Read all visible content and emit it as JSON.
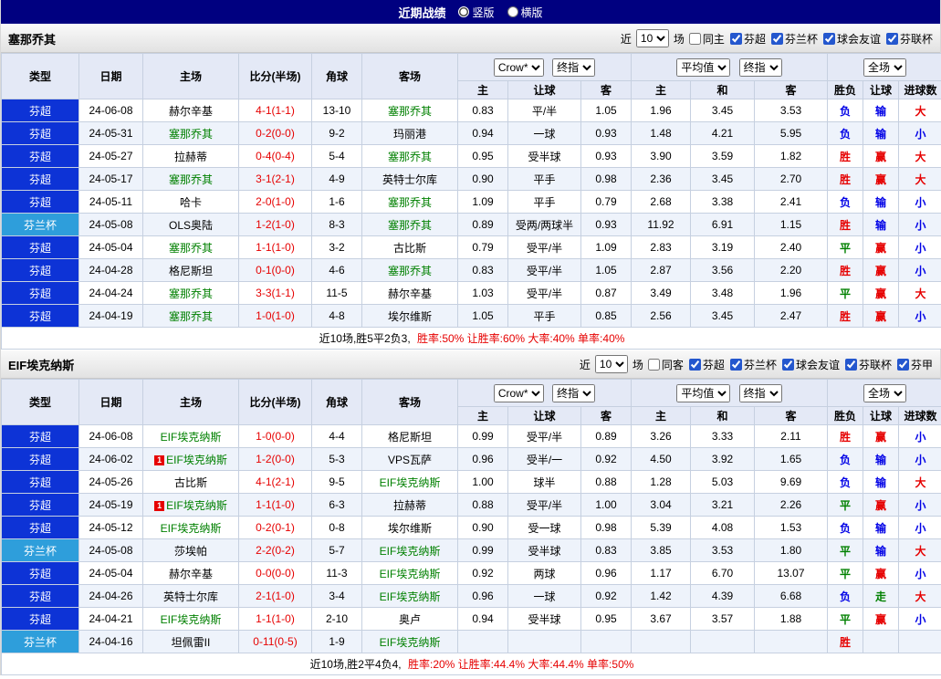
{
  "topbar": {
    "title": "近期战绩",
    "options": [
      {
        "label": "竖版",
        "selected": true
      },
      {
        "label": "横版",
        "selected": false
      }
    ]
  },
  "colors": {
    "topbar_bg": "#000080",
    "league_super": "#0d33d6",
    "league_cup": "#2e9edb",
    "highlight_team": "#008000",
    "score_red": "#e60000",
    "win_red": "#e60000",
    "draw_green": "#008000",
    "lose_blue": "#0000e6",
    "header_bg": "#e4e9f6",
    "row_alt": "#eef3fb"
  },
  "columns": {
    "type": "类型",
    "date": "日期",
    "home": "主场",
    "score": "比分(半场)",
    "corners": "角球",
    "away": "客场",
    "h": "主",
    "handicap": "让球",
    "a": "客",
    "eu_h": "主",
    "draw": "和",
    "eu_a": "客",
    "result": "胜负",
    "handicap_result": "让球",
    "goals": "进球数"
  },
  "selects": {
    "company": "Crow*",
    "final": "终指",
    "average": "平均值",
    "full": "全场"
  },
  "sections": [
    {
      "team": "塞那乔其",
      "filters": {
        "near": "近",
        "count": "10",
        "games": "场",
        "checkboxes": [
          {
            "label": "同主",
            "checked": false
          },
          {
            "label": "芬超",
            "checked": true
          },
          {
            "label": "芬兰杯",
            "checked": true
          },
          {
            "label": "球会友谊",
            "checked": true
          },
          {
            "label": "芬联杯",
            "checked": true
          }
        ]
      },
      "rows": [
        {
          "type": "芬超",
          "date": "24-06-08",
          "home": {
            "name": "赫尔辛基"
          },
          "score": "4-1(1-1)",
          "corners": "13-10",
          "away": {
            "name": "塞那乔其",
            "highlight": true
          },
          "asia": [
            "0.83",
            "平/半",
            "1.05"
          ],
          "europe": [
            "1.96",
            "3.45",
            "3.53"
          ],
          "results": [
            "负",
            "输",
            "大"
          ]
        },
        {
          "type": "芬超",
          "date": "24-05-31",
          "home": {
            "name": "塞那乔其",
            "highlight": true
          },
          "score": "0-2(0-0)",
          "corners": "9-2",
          "away": {
            "name": "玛丽港"
          },
          "asia": [
            "0.94",
            "一球",
            "0.93"
          ],
          "europe": [
            "1.48",
            "4.21",
            "5.95"
          ],
          "results": [
            "负",
            "输",
            "小"
          ]
        },
        {
          "type": "芬超",
          "date": "24-05-27",
          "home": {
            "name": "拉赫蒂"
          },
          "score": "0-4(0-4)",
          "corners": "5-4",
          "away": {
            "name": "塞那乔其",
            "highlight": true
          },
          "asia": [
            "0.95",
            "受半球",
            "0.93"
          ],
          "europe": [
            "3.90",
            "3.59",
            "1.82"
          ],
          "results": [
            "胜",
            "赢",
            "大"
          ]
        },
        {
          "type": "芬超",
          "date": "24-05-17",
          "home": {
            "name": "塞那乔其",
            "highlight": true
          },
          "score": "3-1(2-1)",
          "corners": "4-9",
          "away": {
            "name": "英特士尔库"
          },
          "asia": [
            "0.90",
            "平手",
            "0.98"
          ],
          "europe": [
            "2.36",
            "3.45",
            "2.70"
          ],
          "results": [
            "胜",
            "赢",
            "大"
          ]
        },
        {
          "type": "芬超",
          "date": "24-05-11",
          "home": {
            "name": "哈卡"
          },
          "score": "2-0(1-0)",
          "corners": "1-6",
          "away": {
            "name": "塞那乔其",
            "highlight": true
          },
          "asia": [
            "1.09",
            "平手",
            "0.79"
          ],
          "europe": [
            "2.68",
            "3.38",
            "2.41"
          ],
          "results": [
            "负",
            "输",
            "小"
          ]
        },
        {
          "type": "芬兰杯",
          "date": "24-05-08",
          "home": {
            "name": "OLS奥陆"
          },
          "score": "1-2(1-0)",
          "corners": "8-3",
          "away": {
            "name": "塞那乔其",
            "highlight": true
          },
          "asia": [
            "0.89",
            "受两/两球半",
            "0.93"
          ],
          "europe": [
            "11.92",
            "6.91",
            "1.15"
          ],
          "results": [
            "胜",
            "输",
            "小"
          ]
        },
        {
          "type": "芬超",
          "date": "24-05-04",
          "home": {
            "name": "塞那乔其",
            "highlight": true
          },
          "score": "1-1(1-0)",
          "corners": "3-2",
          "away": {
            "name": "古比斯"
          },
          "asia": [
            "0.79",
            "受平/半",
            "1.09"
          ],
          "europe": [
            "2.83",
            "3.19",
            "2.40"
          ],
          "results": [
            "平",
            "赢",
            "小"
          ]
        },
        {
          "type": "芬超",
          "date": "24-04-28",
          "home": {
            "name": "格尼斯坦"
          },
          "score": "0-1(0-0)",
          "corners": "4-6",
          "away": {
            "name": "塞那乔其",
            "highlight": true
          },
          "asia": [
            "0.83",
            "受平/半",
            "1.05"
          ],
          "europe": [
            "2.87",
            "3.56",
            "2.20"
          ],
          "results": [
            "胜",
            "赢",
            "小"
          ]
        },
        {
          "type": "芬超",
          "date": "24-04-24",
          "home": {
            "name": "塞那乔其",
            "highlight": true
          },
          "score": "3-3(1-1)",
          "corners": "11-5",
          "away": {
            "name": "赫尔辛基"
          },
          "asia": [
            "1.03",
            "受平/半",
            "0.87"
          ],
          "europe": [
            "3.49",
            "3.48",
            "1.96"
          ],
          "results": [
            "平",
            "赢",
            "大"
          ]
        },
        {
          "type": "芬超",
          "date": "24-04-19",
          "home": {
            "name": "塞那乔其",
            "highlight": true
          },
          "score": "1-0(1-0)",
          "corners": "4-8",
          "away": {
            "name": "埃尔维斯"
          },
          "asia": [
            "1.05",
            "平手",
            "0.85"
          ],
          "europe": [
            "2.56",
            "3.45",
            "2.47"
          ],
          "results": [
            "胜",
            "赢",
            "小"
          ]
        }
      ],
      "summary": {
        "prefix": "近10场,胜5平2负3,",
        "stats": "胜率:50% 让胜率:60% 大率:40% 单率:40%"
      }
    },
    {
      "team": "EIF埃克纳斯",
      "filters": {
        "near": "近",
        "count": "10",
        "games": "场",
        "checkboxes": [
          {
            "label": "同客",
            "checked": false
          },
          {
            "label": "芬超",
            "checked": true
          },
          {
            "label": "芬兰杯",
            "checked": true
          },
          {
            "label": "球会友谊",
            "checked": true
          },
          {
            "label": "芬联杯",
            "checked": true
          },
          {
            "label": "芬甲",
            "checked": true
          }
        ]
      },
      "rows": [
        {
          "type": "芬超",
          "date": "24-06-08",
          "home": {
            "name": "EIF埃克纳斯",
            "highlight": true
          },
          "score": "1-0(0-0)",
          "corners": "4-4",
          "away": {
            "name": "格尼斯坦"
          },
          "asia": [
            "0.99",
            "受平/半",
            "0.89"
          ],
          "europe": [
            "3.26",
            "3.33",
            "2.11"
          ],
          "results": [
            "胜",
            "赢",
            "小"
          ]
        },
        {
          "type": "芬超",
          "date": "24-06-02",
          "home": {
            "name": "EIF埃克纳斯",
            "highlight": true,
            "red_card": "1"
          },
          "score": "1-2(0-0)",
          "corners": "5-3",
          "away": {
            "name": "VPS瓦萨"
          },
          "asia": [
            "0.96",
            "受半/一",
            "0.92"
          ],
          "europe": [
            "4.50",
            "3.92",
            "1.65"
          ],
          "results": [
            "负",
            "输",
            "小"
          ]
        },
        {
          "type": "芬超",
          "date": "24-05-26",
          "home": {
            "name": "古比斯"
          },
          "score": "4-1(2-1)",
          "corners": "9-5",
          "away": {
            "name": "EIF埃克纳斯",
            "highlight": true
          },
          "asia": [
            "1.00",
            "球半",
            "0.88"
          ],
          "europe": [
            "1.28",
            "5.03",
            "9.69"
          ],
          "results": [
            "负",
            "输",
            "大"
          ]
        },
        {
          "type": "芬超",
          "date": "24-05-19",
          "home": {
            "name": "EIF埃克纳斯",
            "highlight": true,
            "red_card": "1"
          },
          "score": "1-1(1-0)",
          "corners": "6-3",
          "away": {
            "name": "拉赫蒂"
          },
          "asia": [
            "0.88",
            "受平/半",
            "1.00"
          ],
          "europe": [
            "3.04",
            "3.21",
            "2.26"
          ],
          "results": [
            "平",
            "赢",
            "小"
          ]
        },
        {
          "type": "芬超",
          "date": "24-05-12",
          "home": {
            "name": "EIF埃克纳斯",
            "highlight": true
          },
          "score": "0-2(0-1)",
          "corners": "0-8",
          "away": {
            "name": "埃尔维斯"
          },
          "asia": [
            "0.90",
            "受一球",
            "0.98"
          ],
          "europe": [
            "5.39",
            "4.08",
            "1.53"
          ],
          "results": [
            "负",
            "输",
            "小"
          ]
        },
        {
          "type": "芬兰杯",
          "date": "24-05-08",
          "home": {
            "name": "莎埃帕"
          },
          "score": "2-2(0-2)",
          "corners": "5-7",
          "away": {
            "name": "EIF埃克纳斯",
            "highlight": true
          },
          "asia": [
            "0.99",
            "受半球",
            "0.83"
          ],
          "europe": [
            "3.85",
            "3.53",
            "1.80"
          ],
          "results": [
            "平",
            "输",
            "大"
          ]
        },
        {
          "type": "芬超",
          "date": "24-05-04",
          "home": {
            "name": "赫尔辛基"
          },
          "score": "0-0(0-0)",
          "corners": "11-3",
          "away": {
            "name": "EIF埃克纳斯",
            "highlight": true
          },
          "asia": [
            "0.92",
            "两球",
            "0.96"
          ],
          "europe": [
            "1.17",
            "6.70",
            "13.07"
          ],
          "results": [
            "平",
            "赢",
            "小"
          ]
        },
        {
          "type": "芬超",
          "date": "24-04-26",
          "home": {
            "name": "英特士尔库"
          },
          "score": "2-1(1-0)",
          "corners": "3-4",
          "away": {
            "name": "EIF埃克纳斯",
            "highlight": true
          },
          "asia": [
            "0.96",
            "一球",
            "0.92"
          ],
          "europe": [
            "1.42",
            "4.39",
            "6.68"
          ],
          "results": [
            "负",
            "走",
            "大"
          ]
        },
        {
          "type": "芬超",
          "date": "24-04-21",
          "home": {
            "name": "EIF埃克纳斯",
            "highlight": true
          },
          "score": "1-1(1-0)",
          "corners": "2-10",
          "away": {
            "name": "奥卢"
          },
          "asia": [
            "0.94",
            "受半球",
            "0.95"
          ],
          "europe": [
            "3.67",
            "3.57",
            "1.88"
          ],
          "results": [
            "平",
            "赢",
            "小"
          ]
        },
        {
          "type": "芬兰杯",
          "date": "24-04-16",
          "home": {
            "name": "坦佩雷II"
          },
          "score": "0-11(0-5)",
          "corners": "1-9",
          "away": {
            "name": "EIF埃克纳斯",
            "highlight": true
          },
          "asia": [
            "",
            "",
            ""
          ],
          "europe": [
            "",
            "",
            ""
          ],
          "results": [
            "胜",
            "",
            ""
          ]
        }
      ],
      "summary": {
        "prefix": "近10场,胜2平4负4,",
        "stats": "胜率:20% 让胜率:44.4% 大率:44.4% 单率:50%"
      }
    }
  ]
}
